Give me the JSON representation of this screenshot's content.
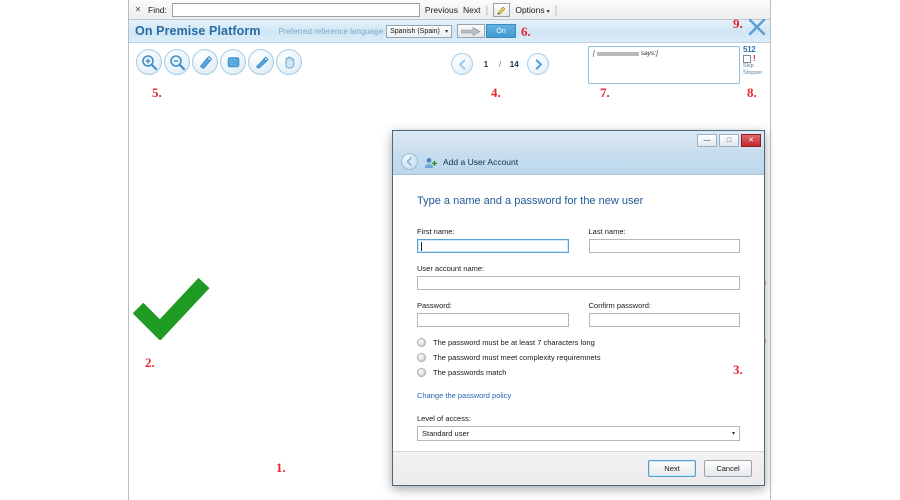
{
  "find_bar": {
    "close_icon": "close-icon",
    "label": "Find:",
    "value": "",
    "previous": "Previous",
    "next": "Next",
    "highlight_icon": "highlighter-icon",
    "options": "Options",
    "caret": "▾"
  },
  "header": {
    "app_title": "On Premise Platform",
    "pref_language_label": "Preferred reference language",
    "language_value": "Spanish (Spain)",
    "language_caret": "▾",
    "arrow_icon": "right-arrow-icon",
    "toggle_label": "On",
    "close_icon": "close-x-icon"
  },
  "toolbar": {
    "icons": [
      {
        "name": "zoom-in-icon",
        "title": "Zoom in"
      },
      {
        "name": "zoom-out-icon",
        "title": "Zoom out"
      },
      {
        "name": "highlighter-icon",
        "title": "Highlight"
      },
      {
        "name": "rectangle-icon",
        "title": "Rectangle"
      },
      {
        "name": "pencil-icon",
        "title": "Draw"
      },
      {
        "name": "hand-icon",
        "title": "Pan"
      }
    ]
  },
  "pager": {
    "prev_icon": "left-arrow-icon",
    "next_icon": "right-arrow-icon",
    "current_page": "1",
    "separator": "/",
    "total_pages": "14"
  },
  "comment_box": {
    "prefix": "[",
    "redacted": "",
    "suffix": "says:]"
  },
  "counter": {
    "count": "512",
    "bang": "!",
    "label_line1": "Skip",
    "label_line2": "Stopper"
  },
  "annotations": [
    {
      "id": "1",
      "label": "1."
    },
    {
      "id": "2",
      "label": "2."
    },
    {
      "id": "3",
      "label": "3."
    },
    {
      "id": "4",
      "label": "4."
    },
    {
      "id": "5",
      "label": "5."
    },
    {
      "id": "6",
      "label": "6."
    },
    {
      "id": "7",
      "label": "7."
    },
    {
      "id": "8",
      "label": "8."
    },
    {
      "id": "9",
      "label": "9."
    }
  ],
  "marks": {
    "check_color": "#1f9b23",
    "cross_color": "#f4363c"
  },
  "dialog": {
    "window_buttons": {
      "minimize": "—",
      "maximize": "□",
      "close": "✕"
    },
    "back_icon": "back-arrow-icon",
    "title_icon": "user-account-icon",
    "title": "Add a User Account",
    "heading": "Type a name and a password for the new user",
    "fields": [
      {
        "key": "first_name",
        "label": "First name:",
        "value": "",
        "focused": true
      },
      {
        "key": "last_name",
        "label": "Last name:",
        "value": "",
        "focused": false
      },
      {
        "key": "user_account_name",
        "label": "User account name:",
        "value": "",
        "focused": false
      },
      {
        "key": "password",
        "label": "Password:",
        "value": "",
        "focused": false
      },
      {
        "key": "confirm_password",
        "label": "Confirm password:",
        "value": "",
        "focused": false
      }
    ],
    "rules": [
      "The password must be at least 7 characters long",
      "The password must meet complexity requiremnets",
      "The passwords match"
    ],
    "policy_link": "Change the password policy",
    "access_label": "Level of access:",
    "access_value": "Standard user",
    "access_caret": "▾",
    "buttons": {
      "next": "Next",
      "cancel": "Cancel"
    }
  },
  "colors": {
    "brand_blue": "#2b6ca3",
    "accent_blue": "#3f9bd2",
    "annotation_red": "#e8252d",
    "dialog_heading": "#1f5a97",
    "link_blue": "#2566ad"
  }
}
